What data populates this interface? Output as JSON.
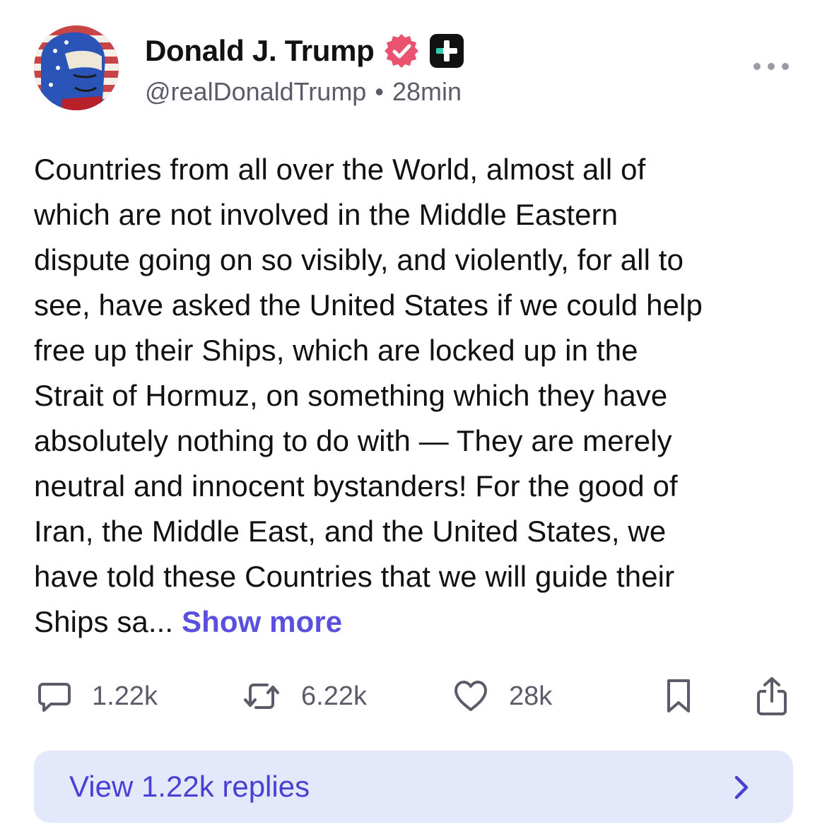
{
  "author": {
    "display_name": "Donald J. Trump",
    "handle": "@realDonaldTrump",
    "separator": "•",
    "time_ago": "28min",
    "verified_icon": "verified-badge-icon",
    "plus_icon": "plus-badge-icon"
  },
  "post": {
    "lines": [
      "Countries from all over the World, almost all of",
      "which are not involved in the Middle Eastern",
      "dispute going on so visibly, and violently, for all to",
      "see, have asked the United States if we could help",
      "free up their Ships, which are locked up in the",
      "Strait of Hormuz, on something which they have",
      "absolutely nothing to do with — They are merely",
      "neutral and innocent bystanders! For the good of",
      "Iran, the Middle East, and the United States, we",
      "have told these Countries that we will guide their"
    ],
    "last_line": "Ships sa...",
    "show_more_label": "Show more"
  },
  "actions": {
    "replies": "1.22k",
    "reposts": "6.22k",
    "likes": "28k"
  },
  "view_replies": {
    "label": "View 1.22k replies"
  },
  "colors": {
    "accent": "#5b4fe0",
    "verified": "#e9536f",
    "muted_text": "#5b5b6a",
    "replies_bg": "#e4e8fb"
  }
}
